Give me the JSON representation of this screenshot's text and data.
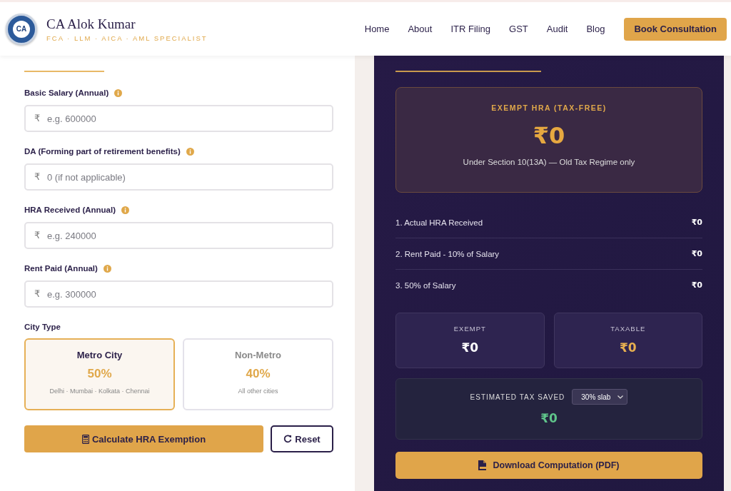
{
  "header": {
    "emblem": "CA",
    "name": "CA Alok Kumar",
    "tagline": "FCA · LLM · AICA · AML SPECIALIST",
    "nav": [
      {
        "label": "Home"
      },
      {
        "label": "About"
      },
      {
        "label": "ITR Filing"
      },
      {
        "label": "GST"
      },
      {
        "label": "Audit"
      },
      {
        "label": "Blog"
      }
    ],
    "cta": "Book Consultation"
  },
  "form": {
    "fields": [
      {
        "label": "Basic Salary (Annual)",
        "info": true,
        "prefix": "₹",
        "placeholder": "e.g. 600000"
      },
      {
        "label": "DA (Forming part of retirement benefits)",
        "info": true,
        "prefix": "₹",
        "placeholder": "0 (if not applicable)"
      },
      {
        "label": "HRA Received (Annual)",
        "info": true,
        "prefix": "₹",
        "placeholder": "e.g. 240000"
      },
      {
        "label": "Rent Paid (Annual)",
        "info": true,
        "prefix": "₹",
        "placeholder": "e.g. 300000"
      }
    ],
    "city_type": {
      "label": "City Type",
      "options": [
        {
          "name": "Metro City",
          "rate": "50%",
          "note": "Delhi · Mumbai · Kolkata · Chennai",
          "selected": true
        },
        {
          "name": "Non-Metro",
          "rate": "40%",
          "note": "All other cities",
          "selected": false
        }
      ]
    },
    "calculate": "Calculate HRA Exemption",
    "reset": "Reset"
  },
  "result": {
    "hero": {
      "title": "EXEMPT HRA (TAX-FREE)",
      "amount": "₹0",
      "note": "Under Section 10(13A) — Old Tax Regime only"
    },
    "rows": [
      {
        "label": "1. Actual HRA Received",
        "value": "₹0"
      },
      {
        "label": "2. Rent Paid - 10% of Salary",
        "value": "₹0"
      },
      {
        "label": "3. 50% of Salary",
        "value": "₹0"
      }
    ],
    "cards": [
      {
        "kind": "exempt",
        "label": "EXEMPT",
        "value": "₹0"
      },
      {
        "kind": "taxable",
        "label": "TAXABLE",
        "value": "₹0"
      }
    ],
    "savings": {
      "label": "ESTIMATED TAX SAVED",
      "slab": "30% slab",
      "amount": "₹0"
    },
    "download": "Download Computation (PDF)"
  }
}
